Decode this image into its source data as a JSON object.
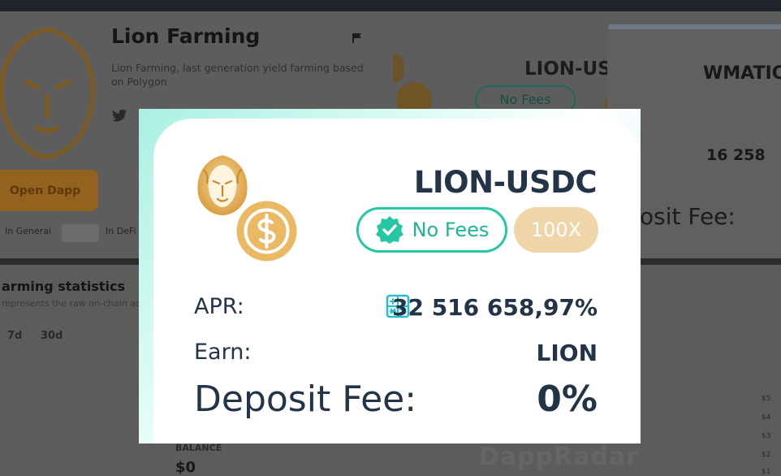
{
  "background": {
    "app_title": "Lion Farming",
    "app_description": "Lion Farming, last generation yield farming based on Polygon",
    "open_dapp_label": "Open Dapp",
    "rank_general_label": "In General",
    "rank_defi_label": "In DeFi",
    "pair_card_title": "LION-US",
    "pair_card_nofees": "No Fees",
    "second_card_title": "WMATIC",
    "second_card_apr": "16 258",
    "second_card_fee_text": "osit Fee:",
    "stats_title": "arming statistics",
    "stats_subtitle": "represents the raw on-chain act",
    "ranges": [
      "7d",
      "30d"
    ],
    "balance_label": "BALANCE",
    "balance_value": "$0",
    "y_ticks": [
      "$5",
      "$4",
      "$3",
      "$2",
      "$1"
    ],
    "watermark": "DappRadar"
  },
  "modal": {
    "pair": "LION-USDC",
    "no_fees_label": "No Fees",
    "multiplier": "100X",
    "apr_label": "APR:",
    "apr_value": "32 516 658,97%",
    "earn_label": "Earn:",
    "earn_value": "LION",
    "deposit_fee_label": "Deposit Fee:",
    "deposit_fee_value": "0%"
  },
  "colors": {
    "navy": "#233449",
    "teal": "#26c7a5",
    "gold": "#e8b760",
    "multiplier_bg": "#efd5a8"
  },
  "icons": [
    "lion-logo-icon",
    "usdc-logo-icon",
    "verified-check-icon",
    "calculator-icon",
    "flag-icon",
    "twitter-icon"
  ]
}
